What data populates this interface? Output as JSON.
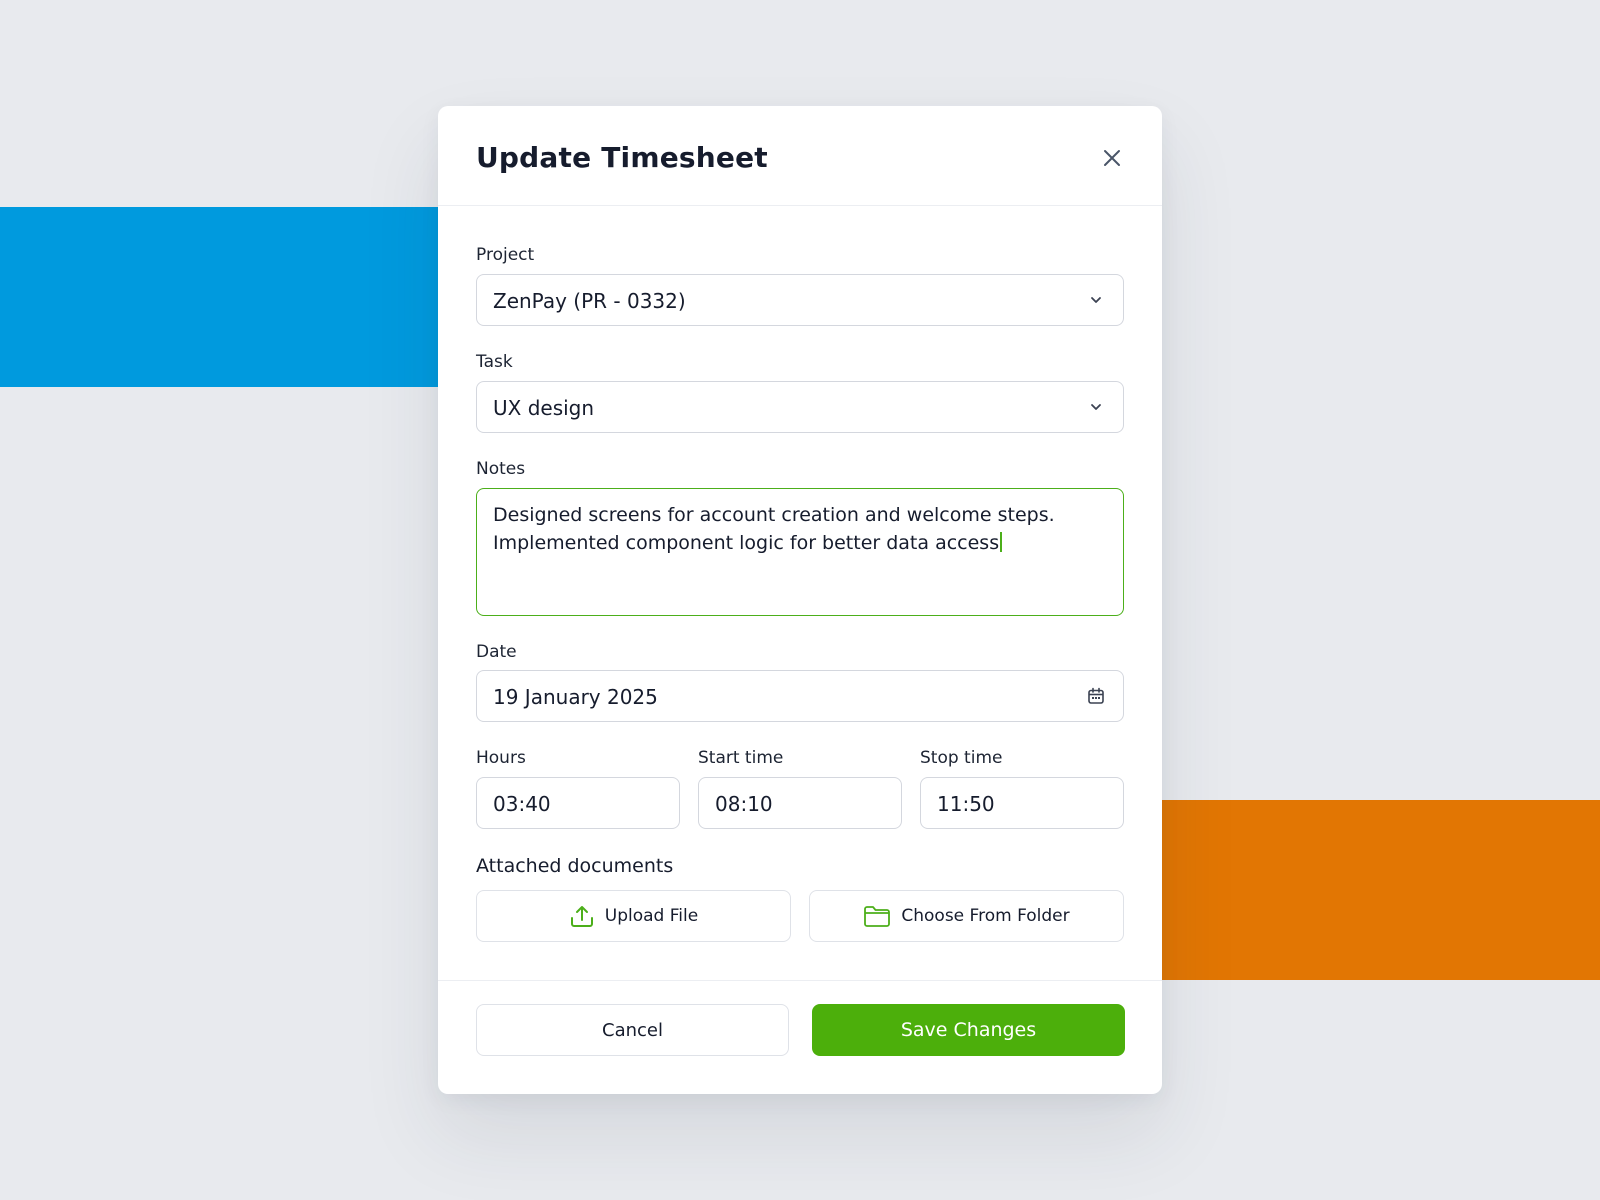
{
  "colors": {
    "background": "#e8eaee",
    "accent_blue": "#009ade",
    "accent_orange": "#e27603",
    "primary_green": "#4caf0b",
    "focus_border": "#4caf1a"
  },
  "modal": {
    "title": "Update Timesheet",
    "close_icon": "close-icon"
  },
  "form": {
    "project": {
      "label": "Project",
      "value": "ZenPay (PR - 0332)",
      "icon": "chevron-down-icon"
    },
    "task": {
      "label": "Task",
      "value": "UX design",
      "icon": "chevron-down-icon"
    },
    "notes": {
      "label": "Notes",
      "value": "Designed screens for account creation and welcome steps.\nImplemented component logic for better data access"
    },
    "date": {
      "label": "Date",
      "value": "19 January 2025",
      "icon": "calendar-icon"
    },
    "hours": {
      "label": "Hours",
      "value": "03:40"
    },
    "start_time": {
      "label": "Start time",
      "value": "08:10"
    },
    "stop_time": {
      "label": "Stop time",
      "value": "11:50"
    }
  },
  "attachments": {
    "title": "Attached documents",
    "upload_label": "Upload File",
    "upload_icon": "upload-icon",
    "folder_label": "Choose From Folder",
    "folder_icon": "folder-icon"
  },
  "footer": {
    "cancel_label": "Cancel",
    "save_label": "Save Changes"
  }
}
